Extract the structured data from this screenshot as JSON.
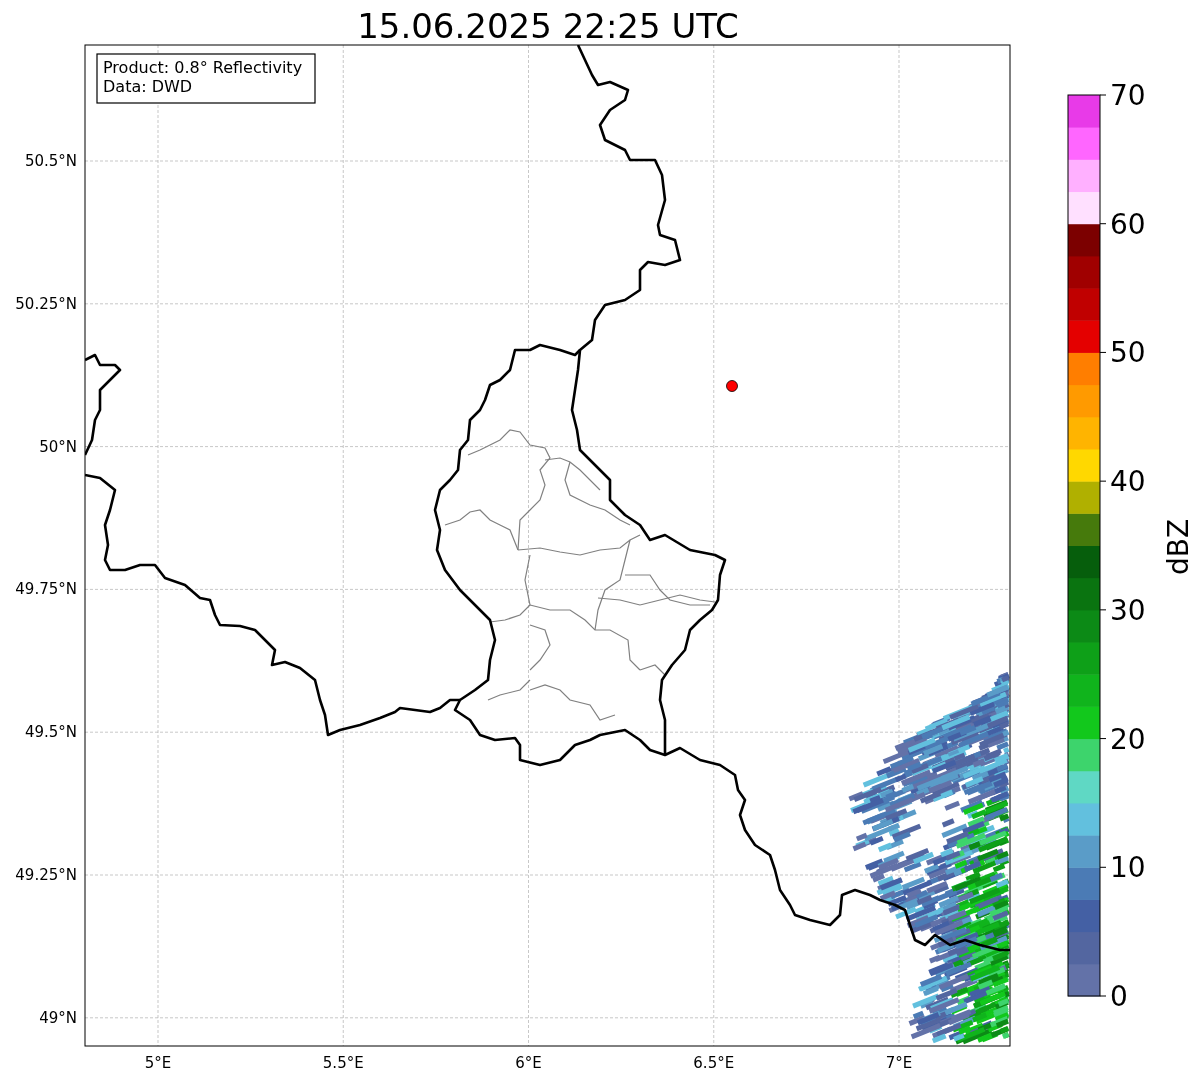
{
  "title": "15.06.2025 22:25 UTC",
  "info": [
    "Product: 0.8° Reflectivity",
    "Data: DWD"
  ],
  "map": {
    "xticks": [
      "5°E",
      "5.5°E",
      "6°E",
      "6.5°E",
      "7°E"
    ],
    "yticks": [
      "50.5°N",
      "50.25°N",
      "50°N",
      "49.75°N",
      "49.5°N",
      "49.25°N",
      "49°N"
    ]
  },
  "colorbar": {
    "label": "dBZ",
    "ticks": [
      "70",
      "60",
      "50",
      "40",
      "30",
      "20",
      "10",
      "0"
    ],
    "levels": [
      {
        "color": "#6372a8"
      },
      {
        "color": "#5366a0"
      },
      {
        "color": "#4460a4"
      },
      {
        "color": "#4b7bb5"
      },
      {
        "color": "#5a9cc8"
      },
      {
        "color": "#62c0de"
      },
      {
        "color": "#5fd8c4"
      },
      {
        "color": "#3dd46c"
      },
      {
        "color": "#12c81c"
      },
      {
        "color": "#10b41c"
      },
      {
        "color": "#0ea018"
      },
      {
        "color": "#0c8a16"
      },
      {
        "color": "#0a7410"
      },
      {
        "color": "#065e0c"
      },
      {
        "color": "#467a0c"
      },
      {
        "color": "#b0b000"
      },
      {
        "color": "#ffd800"
      },
      {
        "color": "#ffb400"
      },
      {
        "color": "#ff9a00"
      },
      {
        "color": "#ff7e00"
      },
      {
        "color": "#e40000"
      },
      {
        "color": "#c00000"
      },
      {
        "color": "#a00000"
      },
      {
        "color": "#7c0000"
      },
      {
        "color": "#ffe0ff"
      },
      {
        "color": "#ffb0ff"
      },
      {
        "color": "#ff66ff"
      },
      {
        "color": "#e83ae8"
      }
    ]
  }
}
